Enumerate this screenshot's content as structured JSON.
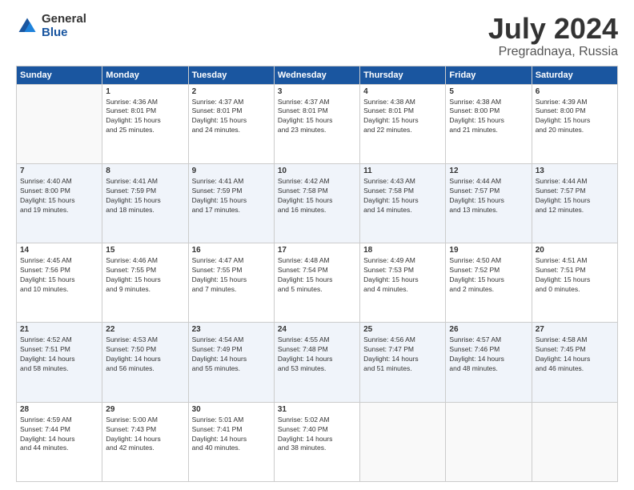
{
  "logo": {
    "general": "General",
    "blue": "Blue"
  },
  "header": {
    "title": "July 2024",
    "subtitle": "Pregradnaya, Russia"
  },
  "weekdays": [
    "Sunday",
    "Monday",
    "Tuesday",
    "Wednesday",
    "Thursday",
    "Friday",
    "Saturday"
  ],
  "weeks": [
    [
      {
        "day": "",
        "info": ""
      },
      {
        "day": "1",
        "info": "Sunrise: 4:36 AM\nSunset: 8:01 PM\nDaylight: 15 hours\nand 25 minutes."
      },
      {
        "day": "2",
        "info": "Sunrise: 4:37 AM\nSunset: 8:01 PM\nDaylight: 15 hours\nand 24 minutes."
      },
      {
        "day": "3",
        "info": "Sunrise: 4:37 AM\nSunset: 8:01 PM\nDaylight: 15 hours\nand 23 minutes."
      },
      {
        "day": "4",
        "info": "Sunrise: 4:38 AM\nSunset: 8:01 PM\nDaylight: 15 hours\nand 22 minutes."
      },
      {
        "day": "5",
        "info": "Sunrise: 4:38 AM\nSunset: 8:00 PM\nDaylight: 15 hours\nand 21 minutes."
      },
      {
        "day": "6",
        "info": "Sunrise: 4:39 AM\nSunset: 8:00 PM\nDaylight: 15 hours\nand 20 minutes."
      }
    ],
    [
      {
        "day": "7",
        "info": "Sunrise: 4:40 AM\nSunset: 8:00 PM\nDaylight: 15 hours\nand 19 minutes."
      },
      {
        "day": "8",
        "info": "Sunrise: 4:41 AM\nSunset: 7:59 PM\nDaylight: 15 hours\nand 18 minutes."
      },
      {
        "day": "9",
        "info": "Sunrise: 4:41 AM\nSunset: 7:59 PM\nDaylight: 15 hours\nand 17 minutes."
      },
      {
        "day": "10",
        "info": "Sunrise: 4:42 AM\nSunset: 7:58 PM\nDaylight: 15 hours\nand 16 minutes."
      },
      {
        "day": "11",
        "info": "Sunrise: 4:43 AM\nSunset: 7:58 PM\nDaylight: 15 hours\nand 14 minutes."
      },
      {
        "day": "12",
        "info": "Sunrise: 4:44 AM\nSunset: 7:57 PM\nDaylight: 15 hours\nand 13 minutes."
      },
      {
        "day": "13",
        "info": "Sunrise: 4:44 AM\nSunset: 7:57 PM\nDaylight: 15 hours\nand 12 minutes."
      }
    ],
    [
      {
        "day": "14",
        "info": "Sunrise: 4:45 AM\nSunset: 7:56 PM\nDaylight: 15 hours\nand 10 minutes."
      },
      {
        "day": "15",
        "info": "Sunrise: 4:46 AM\nSunset: 7:55 PM\nDaylight: 15 hours\nand 9 minutes."
      },
      {
        "day": "16",
        "info": "Sunrise: 4:47 AM\nSunset: 7:55 PM\nDaylight: 15 hours\nand 7 minutes."
      },
      {
        "day": "17",
        "info": "Sunrise: 4:48 AM\nSunset: 7:54 PM\nDaylight: 15 hours\nand 5 minutes."
      },
      {
        "day": "18",
        "info": "Sunrise: 4:49 AM\nSunset: 7:53 PM\nDaylight: 15 hours\nand 4 minutes."
      },
      {
        "day": "19",
        "info": "Sunrise: 4:50 AM\nSunset: 7:52 PM\nDaylight: 15 hours\nand 2 minutes."
      },
      {
        "day": "20",
        "info": "Sunrise: 4:51 AM\nSunset: 7:51 PM\nDaylight: 15 hours\nand 0 minutes."
      }
    ],
    [
      {
        "day": "21",
        "info": "Sunrise: 4:52 AM\nSunset: 7:51 PM\nDaylight: 14 hours\nand 58 minutes."
      },
      {
        "day": "22",
        "info": "Sunrise: 4:53 AM\nSunset: 7:50 PM\nDaylight: 14 hours\nand 56 minutes."
      },
      {
        "day": "23",
        "info": "Sunrise: 4:54 AM\nSunset: 7:49 PM\nDaylight: 14 hours\nand 55 minutes."
      },
      {
        "day": "24",
        "info": "Sunrise: 4:55 AM\nSunset: 7:48 PM\nDaylight: 14 hours\nand 53 minutes."
      },
      {
        "day": "25",
        "info": "Sunrise: 4:56 AM\nSunset: 7:47 PM\nDaylight: 14 hours\nand 51 minutes."
      },
      {
        "day": "26",
        "info": "Sunrise: 4:57 AM\nSunset: 7:46 PM\nDaylight: 14 hours\nand 48 minutes."
      },
      {
        "day": "27",
        "info": "Sunrise: 4:58 AM\nSunset: 7:45 PM\nDaylight: 14 hours\nand 46 minutes."
      }
    ],
    [
      {
        "day": "28",
        "info": "Sunrise: 4:59 AM\nSunset: 7:44 PM\nDaylight: 14 hours\nand 44 minutes."
      },
      {
        "day": "29",
        "info": "Sunrise: 5:00 AM\nSunset: 7:43 PM\nDaylight: 14 hours\nand 42 minutes."
      },
      {
        "day": "30",
        "info": "Sunrise: 5:01 AM\nSunset: 7:41 PM\nDaylight: 14 hours\nand 40 minutes."
      },
      {
        "day": "31",
        "info": "Sunrise: 5:02 AM\nSunset: 7:40 PM\nDaylight: 14 hours\nand 38 minutes."
      },
      {
        "day": "",
        "info": ""
      },
      {
        "day": "",
        "info": ""
      },
      {
        "day": "",
        "info": ""
      }
    ]
  ]
}
